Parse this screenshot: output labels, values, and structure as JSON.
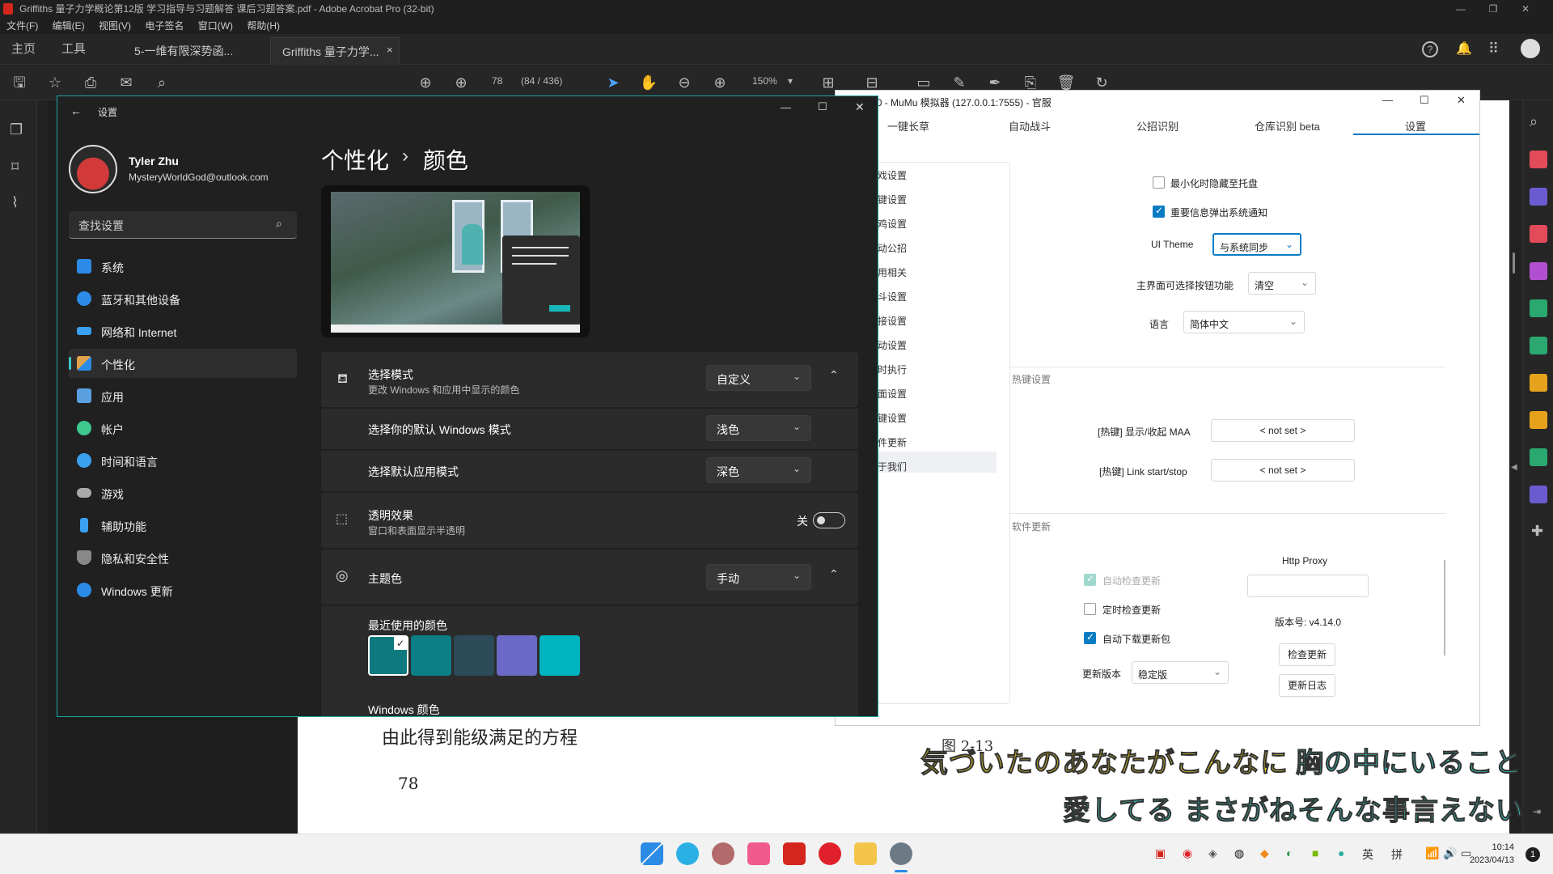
{
  "acrobat": {
    "title": "Griffiths 量子力学概论第12版 学习指导与习题解答 课后习题答案.pdf - Adobe Acrobat Pro (32-bit)",
    "menu": [
      "文件(F)",
      "编辑(E)",
      "视图(V)",
      "电子签名",
      "窗口(W)",
      "帮助(H)"
    ],
    "tabs": {
      "home": "主页",
      "tools": "工具",
      "doc1": "5-一维有限深势函...",
      "doc2": "Griffiths 量子力学...",
      "close": "×"
    },
    "page_num": "78",
    "page_total": "(84 / 436)",
    "zoom": "150%",
    "pdf_text": {
      "equation_line": "由此得到能级满足的方程",
      "page_label": "78",
      "figure_label": "图 2-13"
    }
  },
  "lyrics": {
    "line1_a": "気づいたのあなたがこんなに",
    "line1_b": "胸の中にいること",
    "line2_a": "愛してる",
    "line2_b": "まさがねそんな事言えない"
  },
  "settings": {
    "window_title": "设置",
    "user": {
      "name": "Tyler Zhu",
      "email": "MysteryWorldGod@outlook.com"
    },
    "search_placeholder": "查找设置",
    "nav": [
      {
        "label": "系统",
        "color": "#2b8be6"
      },
      {
        "label": "蓝牙和其他设备",
        "color": "#2b8be6"
      },
      {
        "label": "网络和 Internet",
        "color": "#3aa0f0"
      },
      {
        "label": "个性化",
        "color": "#e3a34c"
      },
      {
        "label": "应用",
        "color": "#5aa0e0"
      },
      {
        "label": "帐户",
        "color": "#3ec88c"
      },
      {
        "label": "时间和语言",
        "color": "#3aa0f0"
      },
      {
        "label": "游戏",
        "color": "#aaaaaa"
      },
      {
        "label": "辅助功能",
        "color": "#3aa0f0"
      },
      {
        "label": "隐私和安全性",
        "color": "#888888"
      },
      {
        "label": "Windows 更新",
        "color": "#2b8be6"
      }
    ],
    "breadcrumb_parent": "个性化",
    "breadcrumb_sep": "›",
    "breadcrumb_current": "颜色",
    "mode": {
      "title": "选择模式",
      "sub": "更改 Windows 和应用中显示的颜色",
      "value": "自定义"
    },
    "win_mode": {
      "title": "选择你的默认 Windows 模式",
      "value": "浅色"
    },
    "app_mode": {
      "title": "选择默认应用模式",
      "value": "深色"
    },
    "transparency": {
      "title": "透明效果",
      "sub": "窗口和表面显示半透明",
      "state": "关"
    },
    "accent": {
      "title": "主题色",
      "value": "手动"
    },
    "recent_colors_label": "最近使用的颜色",
    "recent_colors": [
      "#0e7a80",
      "#0b7e86",
      "#2c4a58",
      "#6b69c6",
      "#00b4c0"
    ],
    "windows_colors_label": "Windows 颜色"
  },
  "maa": {
    "title": "A - v4.14.0 - MuMu 模拟器 (127.0.0.1:7555) - 官服",
    "tabs": [
      "一键长草",
      "自动战斗",
      "公招识别",
      "仓库识别 beta",
      "设置"
    ],
    "active_tab": "设置",
    "side": [
      "戏设置",
      "键设置",
      "鸡设置",
      "动公招",
      "用相关",
      "斗设置",
      "接设置",
      "动设置",
      "时执行",
      "面设置",
      "键设置",
      "件更新",
      "于我们"
    ],
    "minimize_tray": "最小化时隐藏至托盘",
    "notify": "重要信息弹出系统通知",
    "ui_theme_label": "UI Theme",
    "ui_theme_value": "与系统同步",
    "selectable_label": "主界面可选择按钮功能",
    "selectable_value": "清空",
    "lang_label": "语言",
    "lang_value": "简体中文",
    "hotkey_section": "热键设置",
    "hotkey1_label": "[热键] 显示/收起 MAA",
    "hotkey1_value": "< not set >",
    "hotkey2_label": "[热键] Link start/stop",
    "hotkey2_value": "< not set >",
    "update_section": "软件更新",
    "auto_check": "自动检查更新",
    "timed_check": "定时检查更新",
    "auto_download": "自动下载更新包",
    "update_ver_label": "更新版本",
    "update_ver_value": "稳定版",
    "proxy_label": "Http Proxy",
    "proxy_value": "",
    "version": "版本号: v4.14.0",
    "check_btn": "检查更新",
    "log_btn": "更新日志"
  },
  "taskbar": {
    "time": "10:14",
    "date": "2023/04/13",
    "ime1": "英",
    "ime2": "拼",
    "notif": "1"
  }
}
